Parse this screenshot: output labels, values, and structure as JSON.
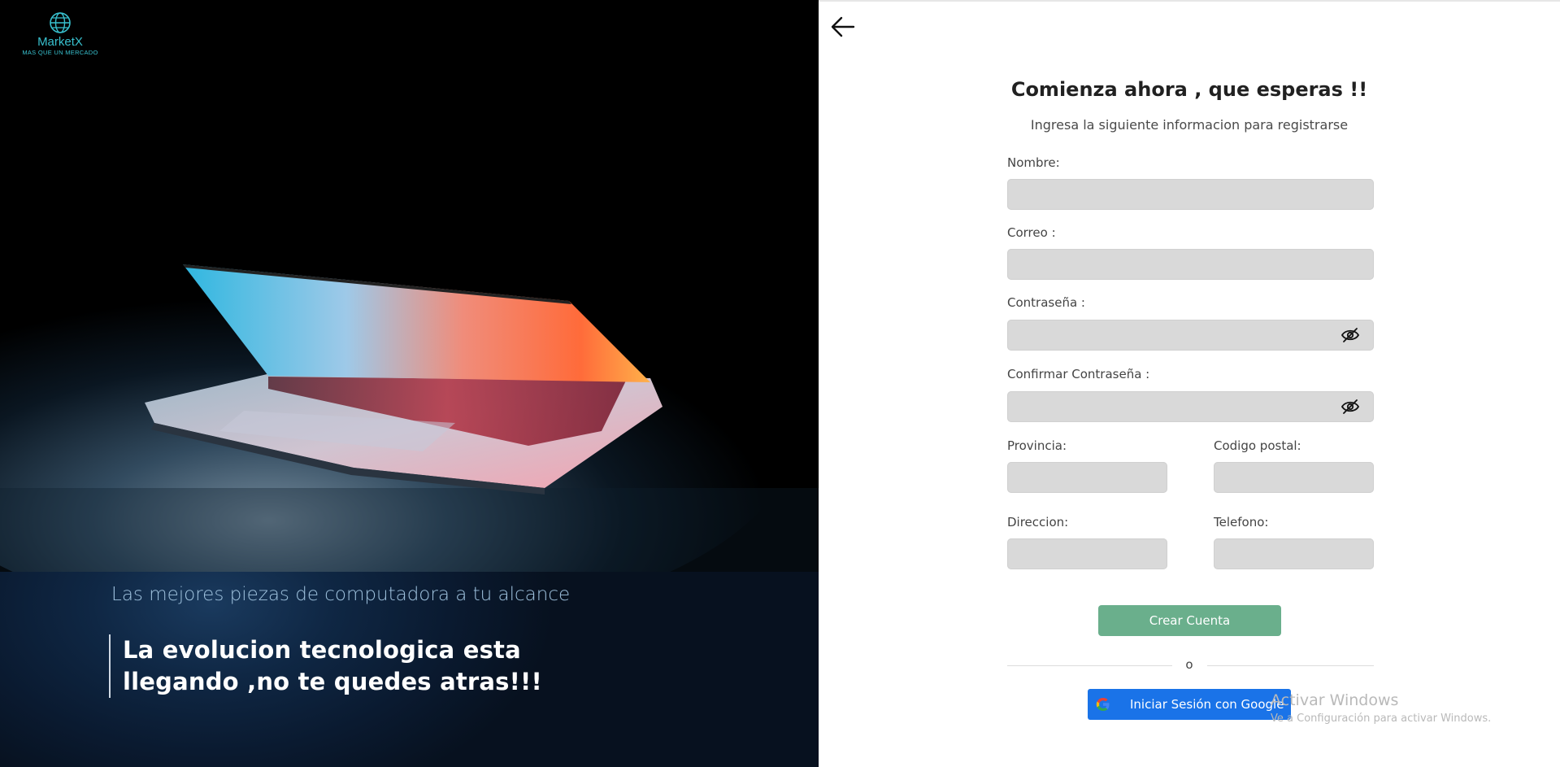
{
  "brand": {
    "name": "MarketX",
    "tagline": "MAS QUE UN MERCADO",
    "accent_color": "#38c0ce"
  },
  "hero": {
    "image": "laptop-dark-photo",
    "subtitle": "Las mejores piezas de computadora a tu alcance",
    "quote_line1": "La evolucion tecnologica esta",
    "quote_line2": "llegando ,no te quedes atras!!!"
  },
  "nav": {
    "back_icon": "arrow-left-icon"
  },
  "form": {
    "title": "Comienza ahora , que esperas !!",
    "subtitle": "Ingresa la siguiente informacion para registrarse",
    "fields": {
      "nombre": {
        "label": "Nombre:",
        "value": ""
      },
      "correo": {
        "label": "Correo :",
        "value": ""
      },
      "contrasena": {
        "label": "Contraseña :",
        "value": "",
        "icon": "eye-slash-icon"
      },
      "confirmar": {
        "label": "Confirmar Contraseña :",
        "value": "",
        "icon": "eye-slash-icon"
      },
      "provincia": {
        "label": "Provincia:",
        "value": ""
      },
      "codigo_postal": {
        "label": "Codigo postal:",
        "value": ""
      },
      "direccion": {
        "label": "Direccion:",
        "value": ""
      },
      "telefono": {
        "label": "Telefono:",
        "value": ""
      }
    },
    "submit_label": "Crear Cuenta",
    "submit_color": "#6aaf8c",
    "divider_text": "o",
    "google_label": "Iniciar Sesión con Google",
    "google_color": "#1a73e8"
  },
  "watermark": {
    "title": "Activar Windows",
    "subtitle": "Ve a Configuración para activar Windows."
  }
}
